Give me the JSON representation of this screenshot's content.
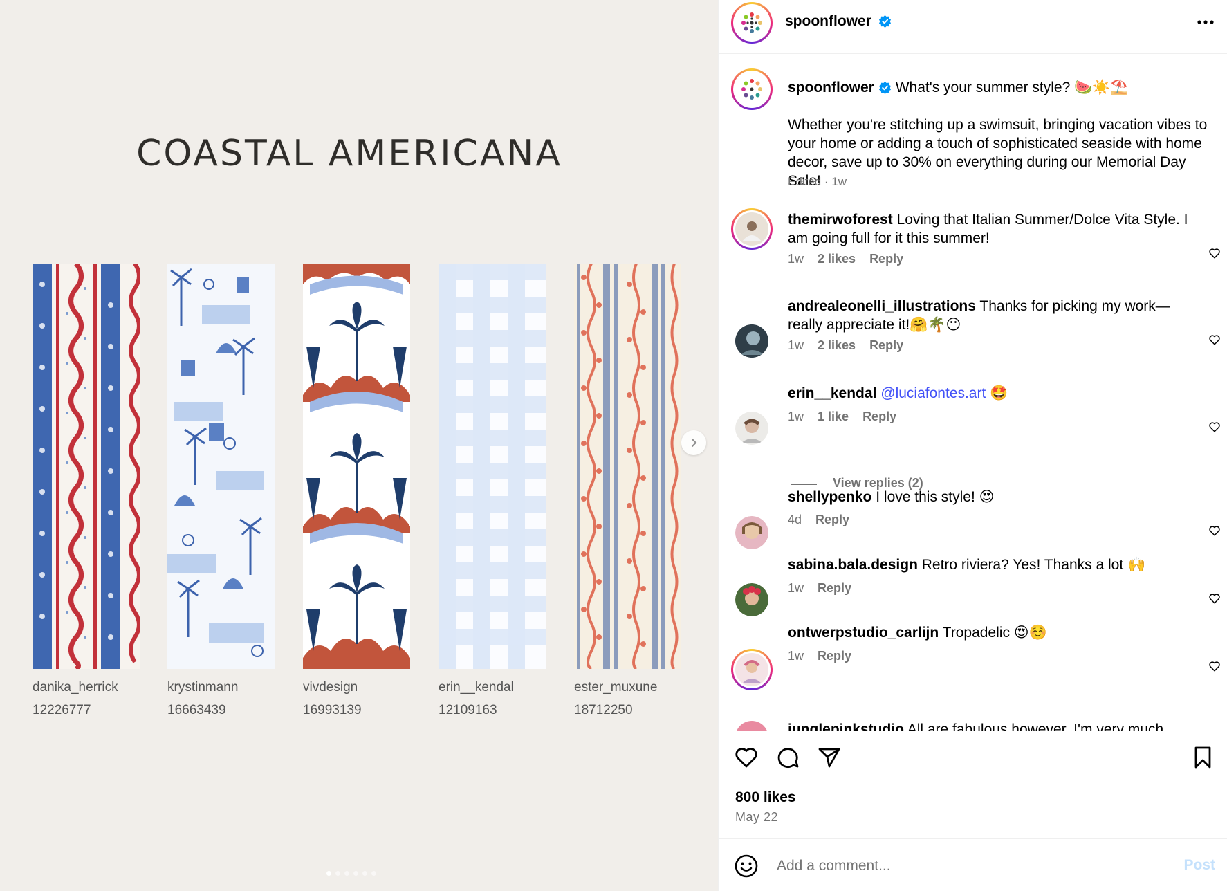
{
  "post": {
    "title": "COASTAL AMERICANA",
    "swatches": [
      {
        "designer": "danika_herrick",
        "id": "12226777"
      },
      {
        "designer": "krystinmann",
        "id": "16663439"
      },
      {
        "designer": "vivdesign",
        "id": "16993139"
      },
      {
        "designer": "erin__kendal",
        "id": "12109163"
      },
      {
        "designer": "ester_muxune",
        "id": "18712250"
      }
    ],
    "carousel": {
      "slide_count": 6,
      "active_index": 0
    }
  },
  "header": {
    "username": "spoonflower",
    "verified_icon": "verified-badge-icon",
    "more_icon": "more-options-icon"
  },
  "caption": {
    "username": "spoonflower",
    "headline": "What's your summer style? 🍉☀️⛱️",
    "body": "Whether you're stitching up a swimsuit, bringing vacation vibes to your home or adding a touch of sophisticated seaside with home decor, save up to 30% on everything during our Memorial Day Sale!",
    "meta": "Edited · 1w"
  },
  "comments": [
    {
      "user": "themirwoforest",
      "text": "Loving that Italian Summer/Dolce Vita Style. I am going full for it this summer!",
      "time": "1w",
      "likes": "2 likes",
      "reply": "Reply"
    },
    {
      "user": "andrealeonelli_illustrations",
      "text": "Thanks for picking my work—really appreciate it!🤗🌴😶",
      "time": "1w",
      "likes": "2 likes",
      "reply": "Reply"
    },
    {
      "user": "erin__kendal",
      "mention": "@luciafontes.art",
      "text": "🤩",
      "time": "1w",
      "likes": "1 like",
      "reply": "Reply",
      "view_replies": "View replies (2)"
    },
    {
      "user": "shellypenko",
      "text": "I love this style! 😍",
      "time": "4d",
      "reply": "Reply"
    },
    {
      "user": "sabina.bala.design",
      "text": "Retro riviera? Yes! Thanks a lot 🙌",
      "time": "1w",
      "reply": "Reply"
    },
    {
      "user": "ontwerpstudio_carlijn",
      "text": "Tropadelic 😍☺️",
      "time": "1w",
      "reply": "Reply"
    },
    {
      "user": "junglepinkstudio",
      "text": "All are fabulous however, I'm very much"
    }
  ],
  "actions": {
    "likes": "800 likes",
    "date": "May 22"
  },
  "add_comment": {
    "placeholder": "Add a comment...",
    "post_label": "Post"
  },
  "colors": {
    "link": "#4150f7",
    "muted": "#737373",
    "post_disabled": "#c5e1fc",
    "media_bg": "#f1eeea"
  }
}
